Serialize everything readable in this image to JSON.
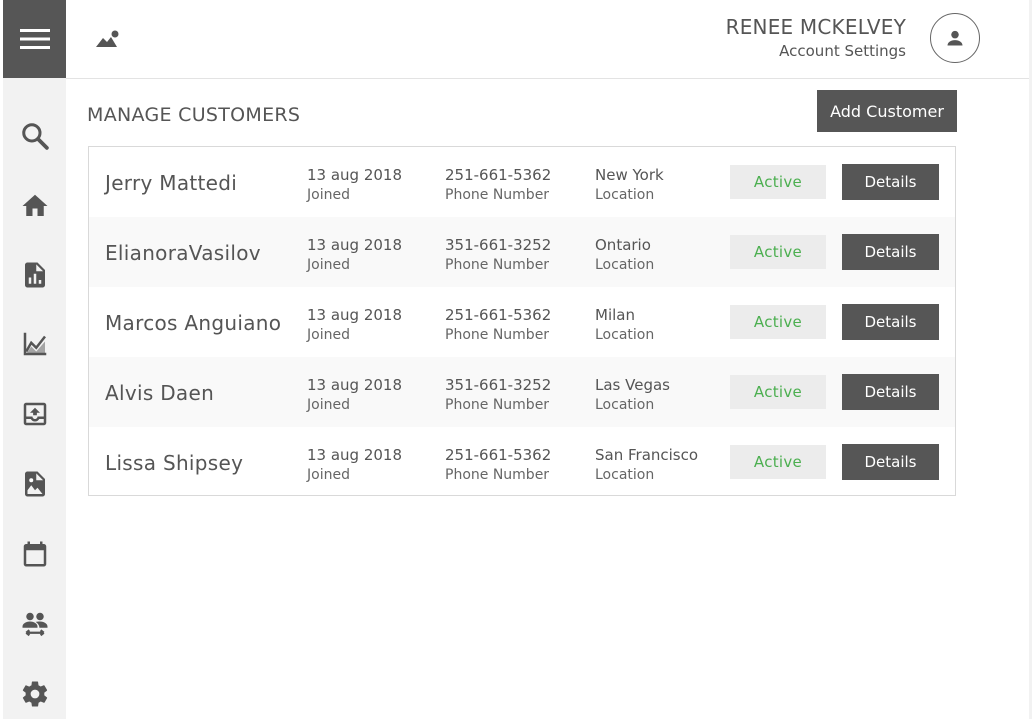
{
  "header": {
    "user_name": "RENEE MCKELVEY",
    "account_link": "Account Settings"
  },
  "sidebar": {
    "items": [
      {
        "name": "search",
        "icon": "search-icon"
      },
      {
        "name": "home",
        "icon": "home-icon"
      },
      {
        "name": "reports",
        "icon": "report-icon"
      },
      {
        "name": "analytics",
        "icon": "line-chart-icon"
      },
      {
        "name": "upload",
        "icon": "upload-icon"
      },
      {
        "name": "images",
        "icon": "image-file-icon"
      },
      {
        "name": "calendar",
        "icon": "calendar-icon"
      },
      {
        "name": "people",
        "icon": "people-transfer-icon"
      },
      {
        "name": "settings",
        "icon": "gear-icon"
      }
    ]
  },
  "main": {
    "title": "MANAGE CUSTOMERS",
    "add_button": "Add Customer",
    "customers": [
      {
        "name": "Jerry Mattedi",
        "joined": "13 aug 2018",
        "joined_label": "Joined",
        "phone": "251-661-5362",
        "phone_label": "Phone Number",
        "location": "New York",
        "location_label": "Location",
        "status": "Active",
        "details": "Details"
      },
      {
        "name": "ElianoraVasilov",
        "joined": "13 aug 2018",
        "joined_label": "Joined",
        "phone": "351-661-3252",
        "phone_label": "Phone Number",
        "location": "Ontario",
        "location_label": "Location",
        "status": "Active",
        "details": "Details"
      },
      {
        "name": "Marcos Anguiano",
        "joined": "13 aug 2018",
        "joined_label": "Joined",
        "phone": "251-661-5362",
        "phone_label": "Phone Number",
        "location": "Milan",
        "location_label": "Location",
        "status": "Active",
        "details": "Details"
      },
      {
        "name": "Alvis Daen",
        "joined": "13 aug 2018",
        "joined_label": "Joined",
        "phone": "351-661-3252",
        "phone_label": "Phone Number",
        "location": "Las Vegas",
        "location_label": "Location",
        "status": "Active",
        "details": "Details"
      },
      {
        "name": "Lissa Shipsey",
        "joined": "13 aug 2018",
        "joined_label": "Joined",
        "phone": "251-661-5362",
        "phone_label": "Phone Number",
        "location": "San Francisco",
        "location_label": "Location",
        "status": "Active",
        "details": "Details"
      }
    ]
  },
  "colors": {
    "sidebar_bg": "#f2f2f2",
    "dark_button": "#565656",
    "active_text": "#4caf50",
    "badge_bg": "#ececec"
  }
}
